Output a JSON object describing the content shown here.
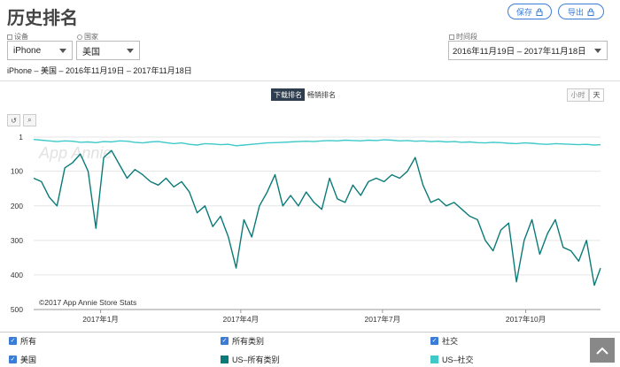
{
  "header": {
    "title": "历史排名",
    "save_label": "保存",
    "export_label": "导出"
  },
  "filters": {
    "device_label": "设备",
    "device_value": "iPhone",
    "country_label": "国家",
    "country_value": "美国",
    "period_label": "时间段",
    "period_value": "2016年11月19日 – 2017年11月18日"
  },
  "subtitle": "iPhone – 美国 – 2016年11月19日 – 2017年11月18日",
  "tabs": {
    "downloads": "下载排名",
    "grossing": "畅销排名"
  },
  "granularity": {
    "hour": "小时",
    "day": "天"
  },
  "watermark": "App Annie",
  "copyright": "©2017 App Annie Store Stats",
  "legend": {
    "all": "所有",
    "all_categories": "所有类别",
    "social": "社交",
    "us": "美国",
    "us_all": "US–所有类别",
    "us_social": "US–社交"
  },
  "colors": {
    "all_categories": "#0a7b78",
    "social": "#3fc9c9",
    "accent": "#3a7cd6"
  },
  "chart_data": {
    "type": "line",
    "y_reversed": true,
    "ylim": [
      1,
      500
    ],
    "yticks": [
      "1",
      "100",
      "200",
      "300",
      "400",
      "500"
    ],
    "xticks": [
      "2017年1月",
      "2017年4月",
      "2017年7月",
      "2017年10月"
    ],
    "x": [
      "2016-11-19",
      "2016-11-24",
      "2016-11-29",
      "2016-12-04",
      "2016-12-09",
      "2016-12-14",
      "2016-12-19",
      "2016-12-24",
      "2016-12-29",
      "2017-01-03",
      "2017-01-08",
      "2017-01-13",
      "2017-01-18",
      "2017-01-23",
      "2017-01-28",
      "2017-02-02",
      "2017-02-07",
      "2017-02-12",
      "2017-02-17",
      "2017-02-22",
      "2017-02-27",
      "2017-03-04",
      "2017-03-09",
      "2017-03-14",
      "2017-03-19",
      "2017-03-24",
      "2017-03-29",
      "2017-04-03",
      "2017-04-08",
      "2017-04-13",
      "2017-04-18",
      "2017-04-23",
      "2017-04-28",
      "2017-05-03",
      "2017-05-08",
      "2017-05-13",
      "2017-05-18",
      "2017-05-23",
      "2017-05-28",
      "2017-06-02",
      "2017-06-07",
      "2017-06-12",
      "2017-06-17",
      "2017-06-22",
      "2017-06-27",
      "2017-07-02",
      "2017-07-07",
      "2017-07-12",
      "2017-07-17",
      "2017-07-22",
      "2017-07-27",
      "2017-08-01",
      "2017-08-06",
      "2017-08-11",
      "2017-08-16",
      "2017-08-21",
      "2017-08-26",
      "2017-08-31",
      "2017-09-05",
      "2017-09-10",
      "2017-09-15",
      "2017-09-20",
      "2017-09-25",
      "2017-09-30",
      "2017-10-05",
      "2017-10-10",
      "2017-10-15",
      "2017-10-20",
      "2017-10-25",
      "2017-10-30",
      "2017-11-04",
      "2017-11-09",
      "2017-11-14",
      "2017-11-18"
    ],
    "series": [
      {
        "name": "US–所有类别",
        "values": [
          120,
          130,
          175,
          200,
          90,
          75,
          50,
          100,
          265,
          60,
          40,
          80,
          120,
          95,
          110,
          130,
          140,
          120,
          145,
          130,
          160,
          220,
          200,
          260,
          230,
          290,
          380,
          240,
          290,
          200,
          160,
          110,
          200,
          170,
          200,
          160,
          190,
          210,
          120,
          180,
          190,
          140,
          170,
          130,
          120,
          130,
          110,
          120,
          100,
          60,
          140,
          190,
          180,
          200,
          190,
          210,
          230,
          240,
          300,
          330,
          270,
          250,
          420,
          300,
          240,
          340,
          280,
          240,
          320,
          330,
          360,
          300,
          430,
          380
        ]
      },
      {
        "name": "US–社交",
        "values": [
          8,
          10,
          12,
          14,
          12,
          13,
          16,
          15,
          17,
          14,
          15,
          12,
          13,
          16,
          18,
          15,
          14,
          17,
          20,
          18,
          22,
          24,
          20,
          21,
          23,
          22,
          26,
          24,
          22,
          20,
          18,
          17,
          16,
          15,
          14,
          13,
          14,
          12,
          11,
          12,
          10,
          11,
          12,
          10,
          11,
          9,
          10,
          12,
          11,
          13,
          12,
          14,
          13,
          15,
          14,
          16,
          15,
          17,
          18,
          16,
          17,
          19,
          20,
          18,
          19,
          21,
          22,
          20,
          21,
          22,
          23,
          22,
          24,
          23
        ]
      }
    ]
  }
}
